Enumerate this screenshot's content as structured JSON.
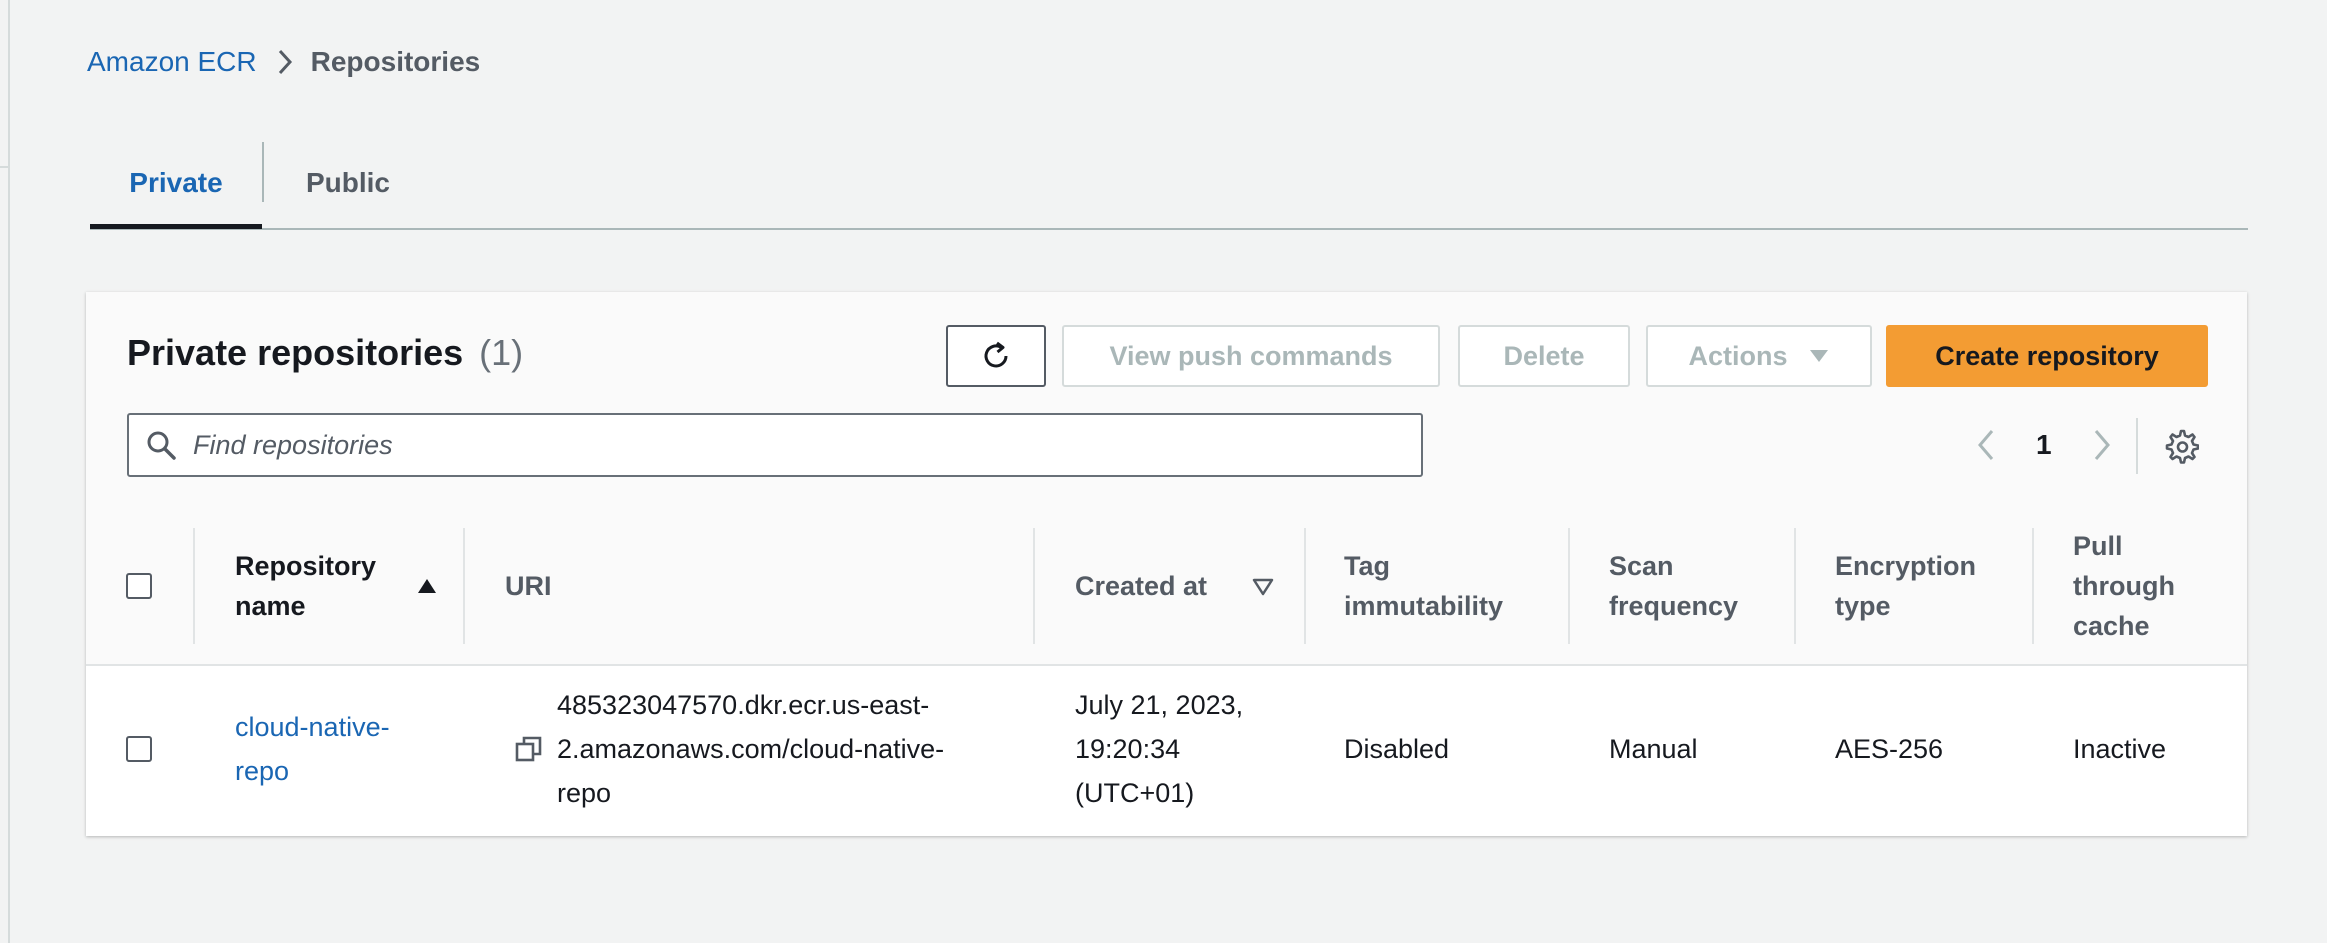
{
  "breadcrumb": {
    "root": "Amazon ECR",
    "current": "Repositories"
  },
  "tabs": [
    {
      "label": "Private",
      "active": true
    },
    {
      "label": "Public",
      "active": false
    }
  ],
  "panel": {
    "title": "Private repositories",
    "count": "(1)",
    "buttons": {
      "refresh_icon": "refresh-icon",
      "view_push": "View push commands",
      "delete": "Delete",
      "actions": "Actions",
      "create": "Create repository"
    },
    "search": {
      "placeholder": "Find repositories",
      "value": ""
    },
    "pager": {
      "page": "1"
    }
  },
  "table": {
    "columns": [
      "Repository name",
      "URI",
      "Created at",
      "Tag immutability",
      "Scan frequency",
      "Encryption type",
      "Pull through cache"
    ],
    "sort": {
      "column": "Repository name",
      "direction": "ascending"
    },
    "rows": [
      {
        "name": "cloud-native-repo",
        "uri": "485323047570.dkr.ecr.us-east-2.amazonaws.com/cloud-native-repo",
        "created_at": "July 21, 2023, 19:20:34 (UTC+01)",
        "tag_immutability": "Disabled",
        "scan_frequency": "Manual",
        "encryption_type": "AES-256",
        "pull_through_cache": "Inactive"
      }
    ]
  },
  "colors": {
    "link": "#1a66b3",
    "primary_button": "#f39c33",
    "background": "#f2f3f3"
  }
}
